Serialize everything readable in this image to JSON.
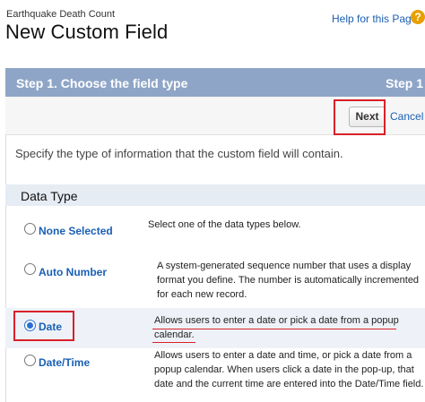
{
  "header": {
    "object_name": "Earthquake Death Count",
    "title": "New Custom Field",
    "help_link": "Help for this Page",
    "help_icon": "?"
  },
  "step": {
    "title": "Step 1. Choose the field type",
    "counter": "Step 1"
  },
  "buttons": {
    "next": "Next",
    "cancel": "Cancel"
  },
  "instruction": "Specify the type of information that the custom field will contain.",
  "section": {
    "title": "Data Type"
  },
  "options": [
    {
      "label": "None Selected",
      "description": "Select one of the data types below.",
      "selected": false
    },
    {
      "label": "Auto Number",
      "description_lines": [
        "A system-generated sequence number that uses a display",
        "format you define. The number is automatically incremented",
        "for each new record."
      ],
      "selected": false
    },
    {
      "label": "Date",
      "description_lines": [
        "Allows users to enter a date or pick a date from a popup",
        "calendar."
      ],
      "selected": true
    },
    {
      "label": "Date/Time",
      "description_lines": [
        "Allows users to enter a date and time, or pick a date from a",
        "popup calendar. When users click a date in the pop-up, that",
        "date and the current time are entered into the Date/Time field."
      ],
      "selected": false
    }
  ],
  "colors": {
    "step_header": "#8ea5c7",
    "link": "#1a5fb4",
    "highlight": "#d9202a",
    "selected_radio": "#2a6ed3"
  }
}
